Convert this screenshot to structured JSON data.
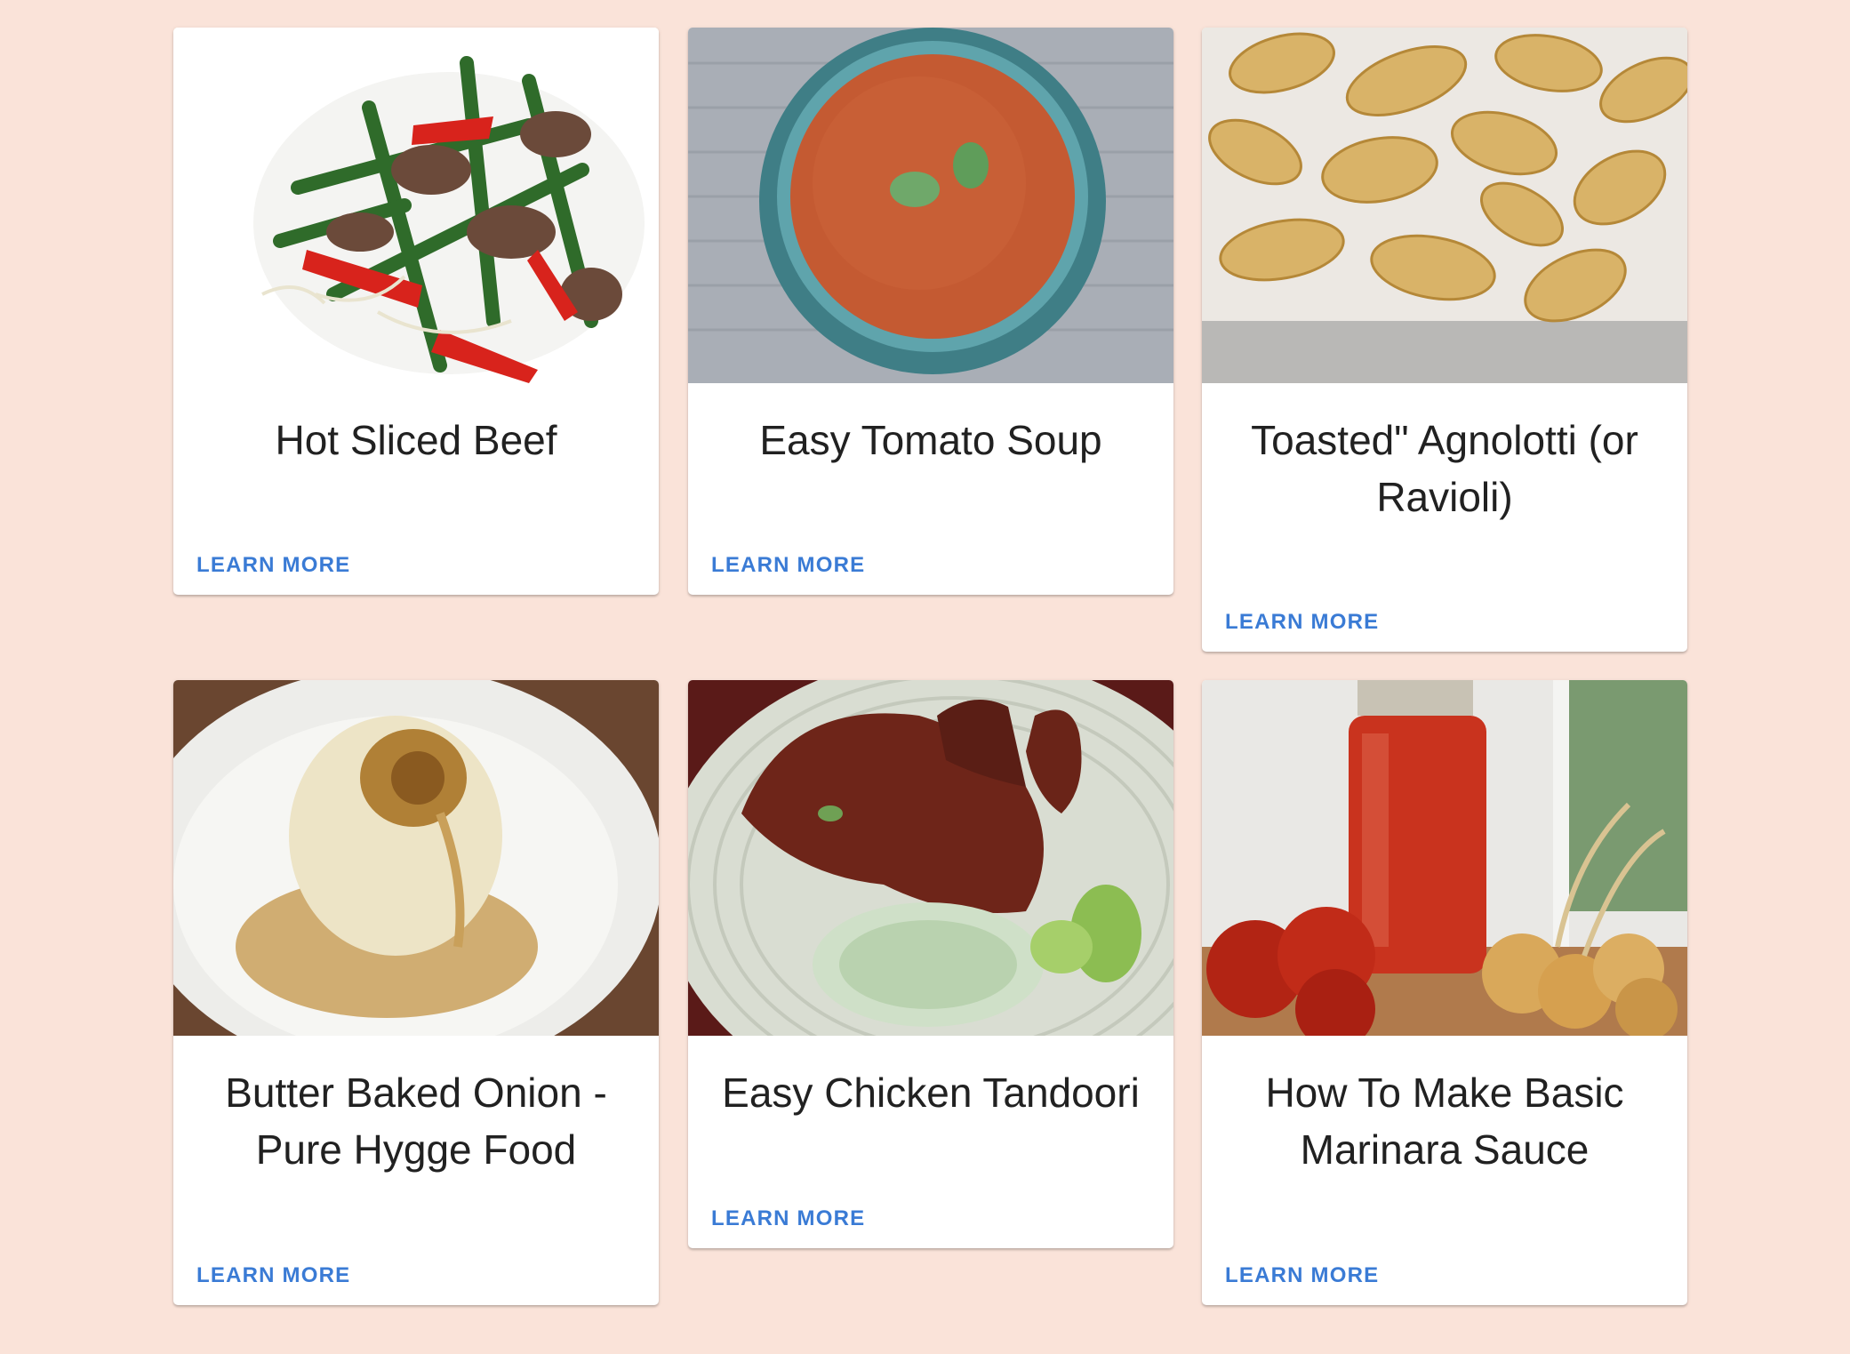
{
  "cards": [
    {
      "title": "Hot Sliced Beef",
      "image": "stir-fry-beef-photo",
      "action": "LEARN MORE"
    },
    {
      "title": "Easy Tomato Soup",
      "image": "tomato-soup-bowl-photo",
      "action": "LEARN MORE"
    },
    {
      "title": "Toasted\" Agnolotti (or Ravioli)",
      "image": "toasted-ravioli-photo",
      "action": "LEARN MORE"
    },
    {
      "title": "Butter Baked Onion - Pure Hygge Food",
      "image": "baked-onion-photo",
      "action": "LEARN MORE"
    },
    {
      "title": "Easy Chicken Tandoori",
      "image": "chicken-tandoori-photo",
      "action": "LEARN MORE"
    },
    {
      "title": "How To Make Basic Marinara Sauce",
      "image": "marinara-jar-photo",
      "action": "LEARN MORE"
    }
  ],
  "colors": {
    "background": "#fae3d9",
    "card": "#ffffff",
    "action": "#3a7bd5",
    "title": "#212121"
  }
}
